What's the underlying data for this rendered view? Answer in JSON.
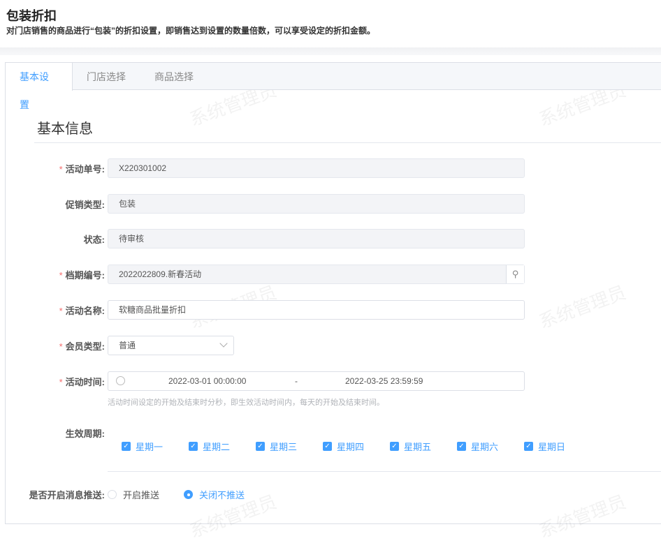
{
  "header": {
    "title": "包装折扣",
    "subtitle": "对门店销售的商品进行“包装”的折扣设置，即销售达到设置的数量倍数，可以享受设定的折扣金额。"
  },
  "tabs": [
    {
      "label": "基本设置",
      "active": true
    },
    {
      "label": "门店选择"
    },
    {
      "label": "商品选择"
    }
  ],
  "section_title": "基本信息",
  "watermark": "系统管理员",
  "form": {
    "activity_no": {
      "label": "活动单号:",
      "value": "X220301002",
      "required": true
    },
    "promo_type": {
      "label": "促销类型:",
      "value": "包装"
    },
    "status": {
      "label": "状态:",
      "value": "待审核"
    },
    "period_no": {
      "label": "档期编号:",
      "value": "2022022809.新春活动",
      "required": true
    },
    "activity_name": {
      "label": "活动名称:",
      "value": "软糖商品批量折扣",
      "required": true
    },
    "member_type": {
      "label": "会员类型:",
      "value": "普通",
      "required": true
    },
    "activity_time": {
      "label": "活动时间:",
      "start": "2022-03-01 00:00:00",
      "separator": "-",
      "end": "2022-03-25 23:59:59",
      "hint": "活动时间设定的开始及结束时分秒，即生效活动时间内，每天的开始及结束时间。",
      "required": true
    },
    "cycle": {
      "label": "生效周期:",
      "days": [
        "星期一",
        "星期二",
        "星期三",
        "星期四",
        "星期五",
        "星期六",
        "星期日"
      ]
    },
    "push": {
      "label": "是否开启消息推送:",
      "options": [
        "开启推送",
        "关闭不推送"
      ],
      "selected": "关闭不推送"
    }
  },
  "colors": {
    "accent": "#409eff",
    "required": "#f56c6c"
  }
}
